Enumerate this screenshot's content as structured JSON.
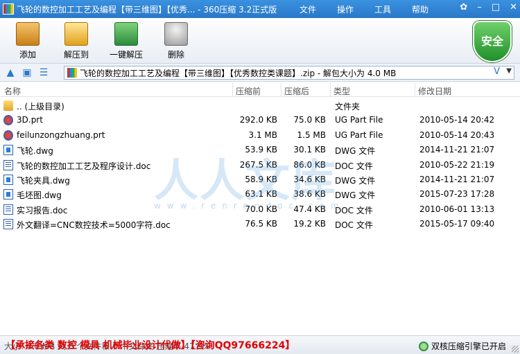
{
  "window": {
    "title": "飞轮的数控加工工艺及编程【带三维图】【优秀... - 360压缩 3.2正式版",
    "controls": [
      "✿",
      "–",
      "□",
      "✕"
    ]
  },
  "menu": [
    "文件",
    "操作",
    "工具",
    "帮助"
  ],
  "toolbar": [
    {
      "label": "添加",
      "icon": "add-archive-icon"
    },
    {
      "label": "解压到",
      "icon": "extract-folder-icon"
    },
    {
      "label": "一键解压",
      "icon": "one-click-extract-icon"
    },
    {
      "label": "删除",
      "icon": "trash-bin-icon"
    }
  ],
  "security_badge": "安全",
  "address": {
    "path": "飞轮的数控加工工艺及编程【带三维图】【优秀数控类课题】.zip - 解包大小为 4.0 MB",
    "v_label": "V"
  },
  "columns": {
    "name": "名称",
    "size": "压缩前",
    "packed": "压缩后",
    "type": "类型",
    "modified": "修改日期"
  },
  "files": [
    {
      "name": ".. (上级目录)",
      "size": "",
      "packed": "",
      "type": "文件夹",
      "modified": "",
      "icon": "folder-icon"
    },
    {
      "name": "3D.prt",
      "size": "292.0 KB",
      "packed": "75.0 KB",
      "type": "UG Part File",
      "modified": "2010-05-14 20:42",
      "icon": "prt-file-icon"
    },
    {
      "name": "feilunzongzhuang.prt",
      "size": "3.1 MB",
      "packed": "1.5 MB",
      "type": "UG Part File",
      "modified": "2010-05-14 20:43",
      "icon": "prt-file-icon"
    },
    {
      "name": "飞轮.dwg",
      "size": "53.9 KB",
      "packed": "30.1 KB",
      "type": "DWG 文件",
      "modified": "2014-11-21 21:07",
      "icon": "dwg-file-icon"
    },
    {
      "name": "飞轮的数控加工工艺及程序设计.doc",
      "size": "267.5 KB",
      "packed": "86.0 KB",
      "type": "DOC 文件",
      "modified": "2010-05-22 21:19",
      "icon": "doc-file-icon"
    },
    {
      "name": "飞轮夹具.dwg",
      "size": "58.9 KB",
      "packed": "34.6 KB",
      "type": "DWG 文件",
      "modified": "2014-11-21 21:07",
      "icon": "dwg-file-icon"
    },
    {
      "name": "毛坯图.dwg",
      "size": "63.1 KB",
      "packed": "38.6 KB",
      "type": "DWG 文件",
      "modified": "2015-07-23 17:28",
      "icon": "dwg-file-icon"
    },
    {
      "name": "实习报告.doc",
      "size": "70.0 KB",
      "packed": "47.4 KB",
      "type": "DOC 文件",
      "modified": "2010-06-01 13:13",
      "icon": "doc-file-icon"
    },
    {
      "name": "外文翻译=CNC数控技术=5000字符.doc",
      "size": "76.5 KB",
      "packed": "19.2 KB",
      "type": "DOC 文件",
      "modified": "2015-05-17 09:40",
      "icon": "doc-file-icon"
    }
  ],
  "watermark": {
    "big": "人人文库",
    "url": "www.renrendoc.com"
  },
  "status": {
    "left": "大小: 4.0 MB 共 8 个文件和 0 个文件夹 压缩率 47.9%",
    "ad": "【承接各类 数控 模具 机械毕业设计代做】【咨询QQ97666224】",
    "right": "双核压缩引擎已开启"
  }
}
